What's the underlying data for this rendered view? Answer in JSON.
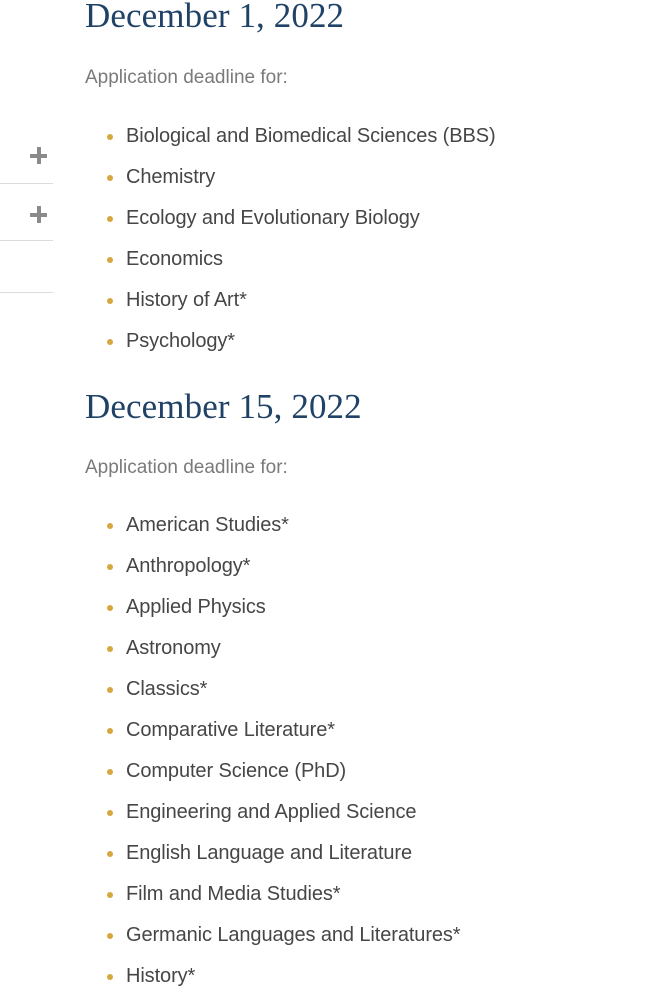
{
  "colors": {
    "heading": "#1f4266",
    "subtitle": "#7a7a7a",
    "list_text": "#464646",
    "bullet": "#d6a73f",
    "divider": "#dcdcdc",
    "icon": "#8a8a8a",
    "background": "#ffffff"
  },
  "accordion": {
    "expand_icon_name": "plus-icon",
    "rows": [
      {
        "id": "accordion-row-1",
        "icon": "+"
      },
      {
        "id": "accordion-row-2",
        "icon": "+"
      }
    ]
  },
  "groups": [
    {
      "heading": "December 1, 2022",
      "subtitle": "Application deadline for:",
      "programs": [
        "Biological and Biomedical Sciences (BBS)",
        "Chemistry",
        "Ecology and Evolutionary Biology",
        "Economics",
        "History of Art*",
        "Psychology*"
      ]
    },
    {
      "heading": "December 15, 2022",
      "subtitle": "Application deadline for:",
      "programs": [
        "American Studies*",
        "Anthropology*",
        "Applied Physics",
        "Astronomy",
        "Classics*",
        "Comparative Literature*",
        "Computer Science (PhD)",
        "Engineering and Applied Science",
        "English Language and Literature",
        "Film and Media Studies*",
        "Germanic Languages and Literatures*",
        "History*"
      ]
    }
  ]
}
